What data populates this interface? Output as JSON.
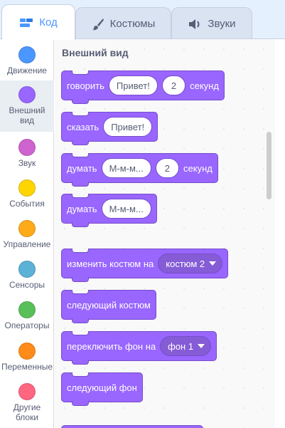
{
  "tabs": [
    {
      "label": "Код",
      "icon": "code-icon",
      "active": true
    },
    {
      "label": "Костюмы",
      "icon": "brush-icon",
      "active": false
    },
    {
      "label": "Звуки",
      "icon": "speaker-icon",
      "active": false
    }
  ],
  "categories": [
    {
      "label": "Движение",
      "color": "#4c97ff"
    },
    {
      "label": "Внешний вид",
      "color": "#9966ff",
      "selected": true
    },
    {
      "label": "Звук",
      "color": "#cf63cf"
    },
    {
      "label": "События",
      "color": "#ffd500"
    },
    {
      "label": "Управление",
      "color": "#ffab19"
    },
    {
      "label": "Сенсоры",
      "color": "#5cb1d6"
    },
    {
      "label": "Операторы",
      "color": "#59c059"
    },
    {
      "label": "Переменные",
      "color": "#ff8c1a"
    },
    {
      "label": "Другие блоки",
      "color": "#ff6680"
    }
  ],
  "palette": {
    "section_title": "Внешний вид",
    "blocks": {
      "say_for": {
        "word": "говорить",
        "text": "Привет!",
        "secs": "2",
        "unit": "секунд"
      },
      "say": {
        "word": "сказать",
        "text": "Привет!"
      },
      "think_for": {
        "word": "думать",
        "text": "М-м-м...",
        "secs": "2",
        "unit": "секунд"
      },
      "think": {
        "word": "думать",
        "text": "М-м-м..."
      },
      "switch_costume": {
        "word": "изменить костюм на",
        "value": "костюм 2"
      },
      "next_costume": {
        "word": "следующий костюм"
      },
      "switch_backdrop": {
        "word": "переключить фон на",
        "value": "фон 1"
      },
      "next_backdrop": {
        "word": "следующий фон"
      }
    }
  },
  "colors": {
    "looks": "#9966ff",
    "accent": "#4c97ff"
  }
}
